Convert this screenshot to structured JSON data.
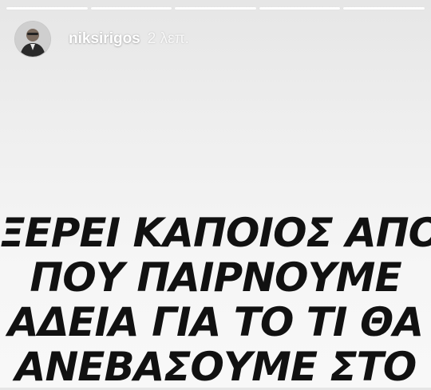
{
  "progress": {
    "segments": 5,
    "filled": 4
  },
  "header": {
    "username": "niksirigos",
    "timestamp": "2 λεπ."
  },
  "story": {
    "lines": [
      "ΞΕΡΕΙ ΚΑΠΟΙΟΣ ΑΠΟ",
      "ΠΟΥ ΠΑΙΡΝΟΥΜΕ",
      "ΑΔΕΙΑ ΓΙΑ ΤΟ ΤΙ ΘΑ",
      "ΑΝΕΒΑΣΟΥΜΕ ΣΤΟ"
    ]
  }
}
